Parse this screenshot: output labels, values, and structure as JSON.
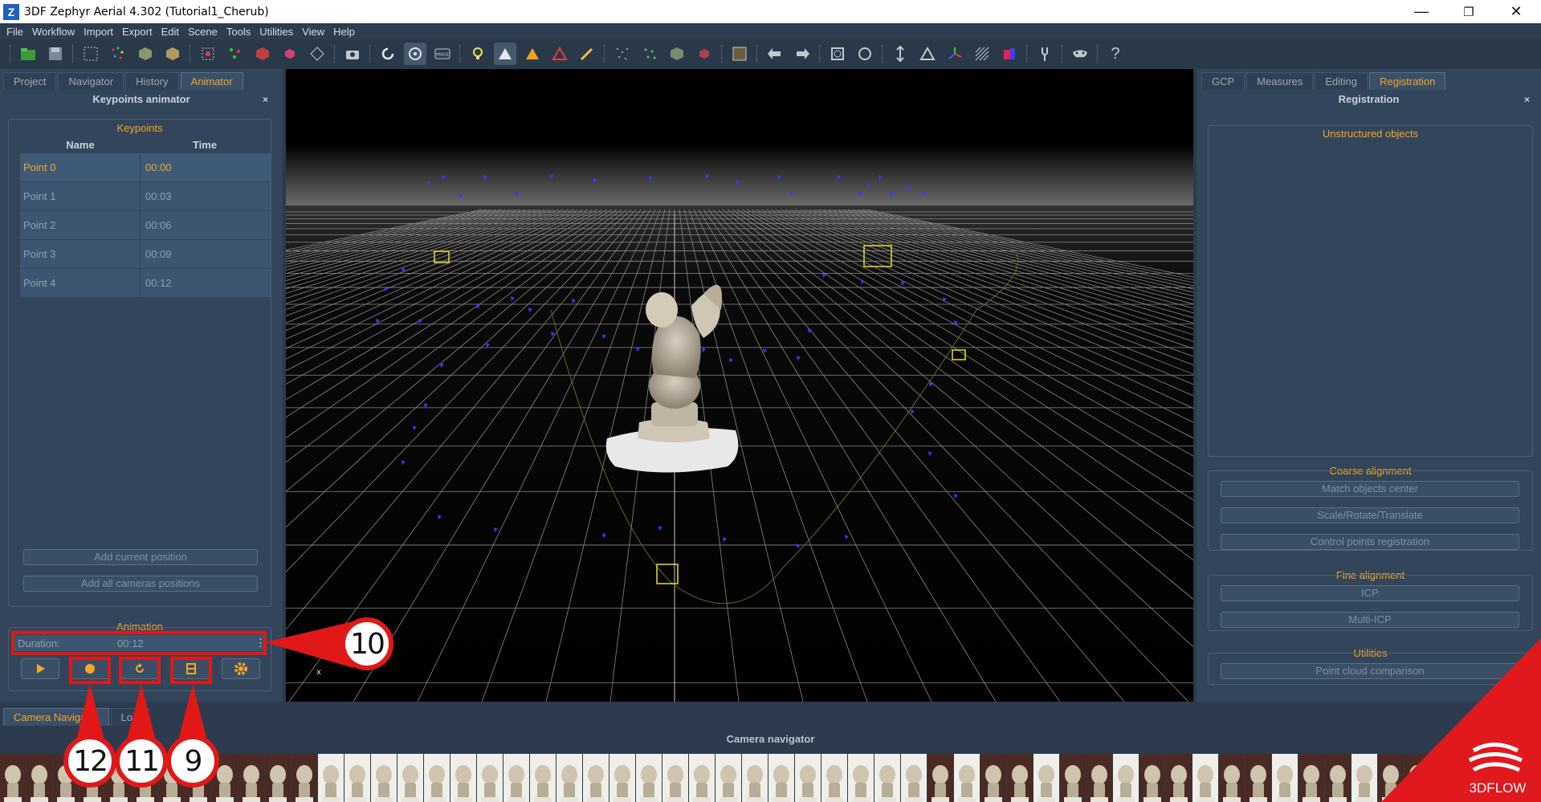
{
  "window": {
    "app_icon": "Z",
    "title": "3DF Zephyr Aerial 4.302 (Tutorial1_Cherub)",
    "minimize_icon": "minimize-icon",
    "restore_icon": "restore-icon",
    "close_icon": "close-icon"
  },
  "menu": [
    "File",
    "Workflow",
    "Import",
    "Export",
    "Edit",
    "Scene",
    "Tools",
    "Utilities",
    "View",
    "Help"
  ],
  "toolbar": {
    "icons": [
      "new-project-icon",
      "save-icon",
      "select-icon",
      "sparse-cloud-icon",
      "dense-cloud-icon",
      "mesh-icon",
      "camera-capture-icon",
      "undo-rotate-icon",
      "orbit-icon",
      "image-icon",
      "light-bulb-icon",
      "mesh-shade-icon",
      "vertex-color-icon",
      "brush-icon",
      "pointcloud-icon",
      "box-icon",
      "arrow-back-icon",
      "arrow-forward-icon",
      "rotate-icon",
      "circle-icon",
      "vertical-icon",
      "measure-icon",
      "axis-icon",
      "grid-icon",
      "render-icon",
      "wrench-icon",
      "mask-icon",
      "help-icon"
    ],
    "help_label": "?",
    "image_label": "IMAGE"
  },
  "left_panel": {
    "tabs": [
      "Project",
      "Navigator",
      "History",
      "Animator"
    ],
    "active_tab": "Animator",
    "header": "Keypoints animator",
    "close_label": "×",
    "keypoints": {
      "title": "Keypoints",
      "columns": [
        "Name",
        "Time"
      ],
      "rows": [
        {
          "name": "Point 0",
          "time": "00:00"
        },
        {
          "name": "Point 1",
          "time": "00:03"
        },
        {
          "name": "Point 2",
          "time": "00:06"
        },
        {
          "name": "Point 3",
          "time": "00:09"
        },
        {
          "name": "Point 4",
          "time": "00:12"
        }
      ],
      "add_current": "Add current position",
      "add_all": "Add all cameras positions"
    },
    "animation": {
      "title": "Animation",
      "duration_label": "Duration:",
      "duration_value": "00:12",
      "spin_label": "⋮",
      "buttons": [
        "play-icon",
        "record-icon",
        "loop-icon",
        "export-video-icon",
        "settings-icon"
      ]
    }
  },
  "right_panel": {
    "tabs": [
      "GCP",
      "Measures",
      "Editing",
      "Registration"
    ],
    "active_tab": "Registration",
    "header": "Registration",
    "close_label": "×",
    "unstructured_title": "Unstructured objects",
    "coarse": {
      "title": "Coarse alignment",
      "buttons": [
        "Match objects center",
        "Scale/Rotate/Translate",
        "Control points registration"
      ]
    },
    "fine": {
      "title": "Fine alignment",
      "buttons": [
        "ICP",
        "Multi-ICP"
      ]
    },
    "utilities": {
      "title": "Utilities",
      "buttons": [
        "Point cloud comparison"
      ]
    }
  },
  "bottom_panel": {
    "tabs": [
      "Camera Navigator",
      "Log"
    ],
    "title": "Camera navigator",
    "thumbnail_count": 57
  },
  "viewport": {
    "axis_label": "x",
    "object": "cherub-statue"
  },
  "callouts": [
    "10",
    "12",
    "11",
    "9"
  ],
  "brand": {
    "logo_text": "3DFLOW",
    "color": "#e0191f"
  },
  "colors": {
    "accent": "#f5a623",
    "annotation_red": "#e01818",
    "camera_blue": "#2a40ff",
    "keyframe_yellow": "#e8e020"
  }
}
